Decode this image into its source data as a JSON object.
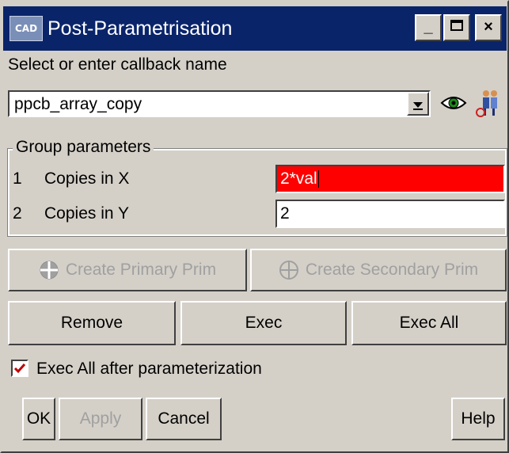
{
  "window": {
    "title": "Post-Parametrisation",
    "logo_text": "CAD",
    "minimize": "_",
    "close": "×"
  },
  "callback": {
    "label": "Select or enter callback name",
    "value": "ppcb_array_copy"
  },
  "group": {
    "title": "Group parameters",
    "rows": [
      {
        "num": "1",
        "name": "Copies in X",
        "value": "2*val",
        "status": "error"
      },
      {
        "num": "2",
        "name": "Copies in Y",
        "value": "2",
        "status": "ok"
      }
    ]
  },
  "prim_buttons": {
    "primary": "Create Primary Prim",
    "secondary": "Create Secondary Prim"
  },
  "actions": {
    "remove": "Remove",
    "exec": "Exec",
    "exec_all": "Exec All"
  },
  "option": {
    "label": "Exec All after parameterization",
    "checked": true
  },
  "footer": {
    "ok": "OK",
    "apply": "Apply",
    "cancel": "Cancel",
    "help": "Help"
  },
  "colors": {
    "titlebar": "#0a246a",
    "error_field": "#ff0000",
    "checkmark": "#c00000",
    "face": "#d4d0c8"
  },
  "icons": {
    "logo": "app-logo-icon",
    "eye": "eye-icon",
    "people": "people-icon",
    "primary": "crosshair-circle-icon",
    "secondary": "crosshair-circle-icon",
    "check": "checkmark-icon"
  }
}
